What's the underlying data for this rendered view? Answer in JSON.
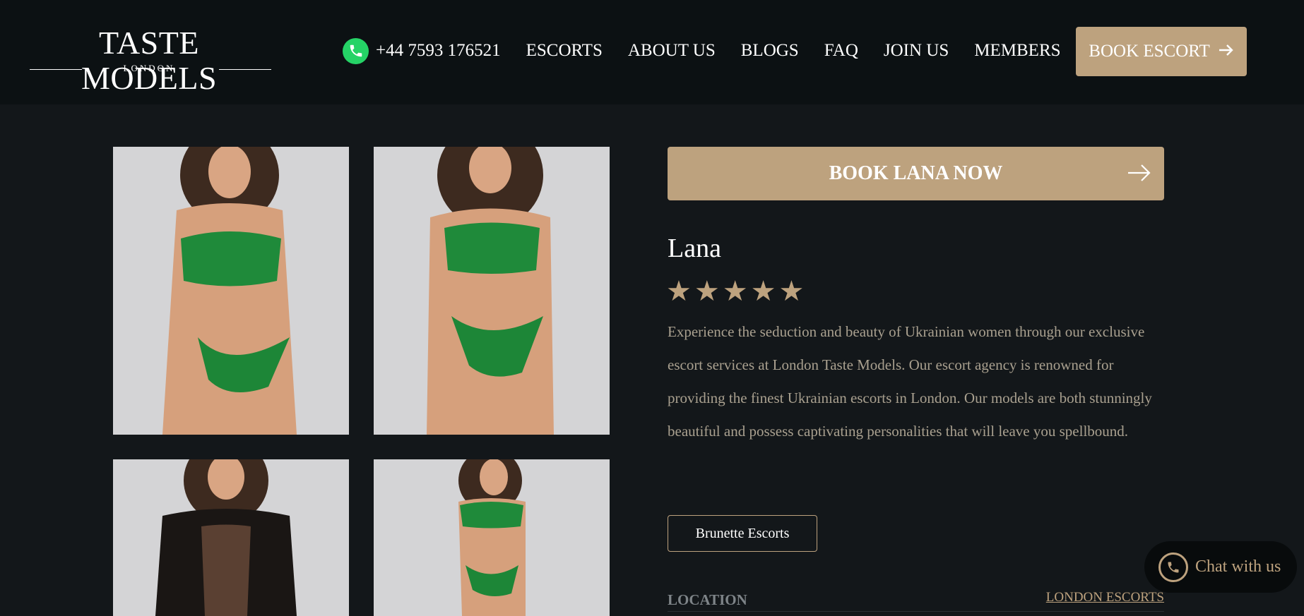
{
  "header": {
    "logo": {
      "title": "TASTE MODELS",
      "subtitle": "LONDON"
    },
    "phone": "+44 7593 176521",
    "nav": [
      "ESCORTS",
      "ABOUT US",
      "BLOGS",
      "FAQ",
      "JOIN US",
      "MEMBERS"
    ],
    "book_button": "BOOK ESCORT"
  },
  "profile": {
    "cta_label": "BOOK LANA NOW",
    "name": "Lana",
    "rating": 5,
    "stars": [
      "★",
      "★",
      "★",
      "★",
      "★"
    ],
    "description": "Experience the seduction and beauty of Ukrainian women through our exclusive escort services at London Taste Models. Our escort agency is renowned for providing the finest Ukrainian escorts in London. Our models are both stunningly beautiful and possess captivating personalities that will leave you spellbound.",
    "tag": "Brunette Escorts",
    "location_label": "LOCATION",
    "location_link": "LONDON ESCORTS"
  },
  "chat": {
    "label": "Chat with us"
  },
  "colors": {
    "accent": "#bda27e",
    "header_bg": "#0c1113",
    "page_bg": "#13171a",
    "whatsapp": "#25d366"
  },
  "icons": {
    "phone": "whatsapp-icon",
    "arrow": "arrow-right-icon",
    "chat": "whatsapp-chat-icon"
  }
}
